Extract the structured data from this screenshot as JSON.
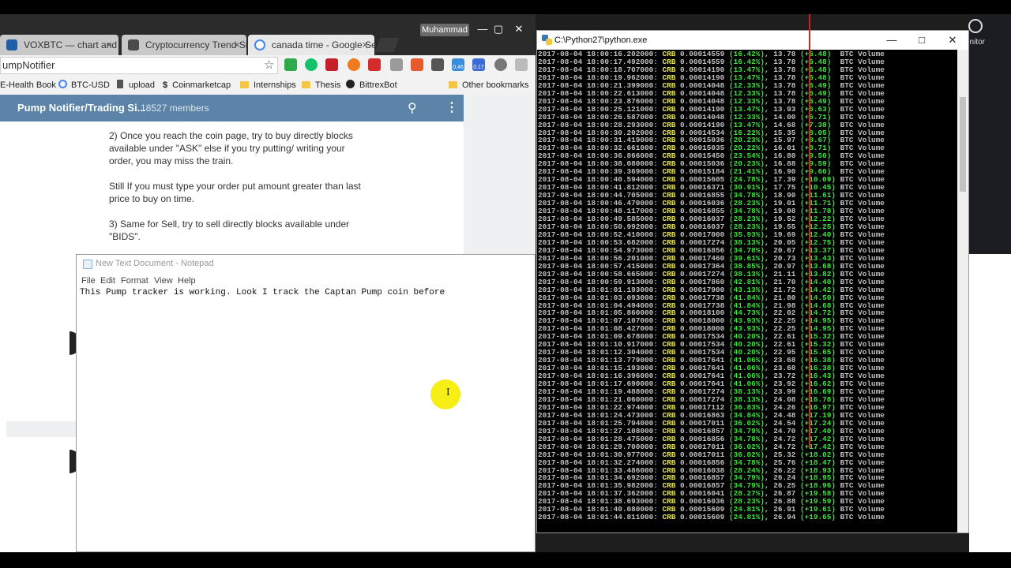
{
  "chrome": {
    "tabs": [
      {
        "label": "VOXBTC — chart and qu",
        "close": "×"
      },
      {
        "label": "Cryptocurrency Trend Si",
        "close": "×"
      },
      {
        "label": "canada time - Google Se",
        "close": "×"
      }
    ],
    "user": "Muhammad",
    "address": "umpNotifier",
    "ext_badges": {
      "a": "0.46",
      "b": "0.17"
    },
    "bookmarks": [
      "E-Health Book",
      "BTC-USD",
      "upload",
      "Coinmarketcap",
      "Internships",
      "Thesis",
      "BittrexBot",
      "Other bookmarks"
    ]
  },
  "telegram": {
    "title": "Pump Notifier/Trading Si...",
    "members": "18527 members",
    "paragraphs": [
      "2) Once you reach the coin page, try to buy directly blocks available under \"ASK\" else if you try putting/ writing your order, you may miss the train.",
      "Still If you must type your order put amount greater than last price to buy on time.",
      "3) Same for Sell, try to sell directly blocks available under \"BIDS\"."
    ]
  },
  "notepad": {
    "title": "New Text Document - Notepad",
    "menu": [
      "File",
      "Edit",
      "Format",
      "View",
      "Help"
    ],
    "content": "This Pump tracker is working. Look I track the Captan Pump coin before"
  },
  "console": {
    "title": "C:\\Python27\\python.exe",
    "lines": [
      [
        "2017-08-04 18:00:16.202000:",
        "CRB",
        "0.00014559",
        "(16.42%)",
        "13.78",
        "(+6.48)"
      ],
      [
        "2017-08-04 18:00:17.492000:",
        "CRB",
        "0.00014559",
        "(16.42%)",
        "13.78",
        "(+6.48)"
      ],
      [
        "2017-08-04 18:00:18.707000:",
        "CRB",
        "0.00014190",
        "(13.47%)",
        "13.78",
        "(+6.48)"
      ],
      [
        "2017-08-04 18:00:19.962000:",
        "CRB",
        "0.00014190",
        "(13.47%)",
        "13.78",
        "(+6.48)"
      ],
      [
        "2017-08-04 18:00:21.399000:",
        "CRB",
        "0.00014048",
        "(12.33%)",
        "13.78",
        "(+6.49)"
      ],
      [
        "2017-08-04 18:00:22.613000:",
        "CRB",
        "0.00014048",
        "(12.33%)",
        "13.78",
        "(+6.49)"
      ],
      [
        "2017-08-04 18:00:23.876000:",
        "CRB",
        "0.00014048",
        "(12.33%)",
        "13.78",
        "(+6.49)"
      ],
      [
        "2017-08-04 18:00:25.121000:",
        "CRB",
        "0.00014190",
        "(13.47%)",
        "13.93",
        "(+6.63)"
      ],
      [
        "2017-08-04 18:00:26.587000:",
        "CRB",
        "0.00014048",
        "(12.33%)",
        "14.00",
        "(+6.71)"
      ],
      [
        "2017-08-04 18:00:28.293000:",
        "CRB",
        "0.00014190",
        "(13.47%)",
        "14.68",
        "(+7.38)"
      ],
      [
        "2017-08-04 18:00:30.202000:",
        "CRB",
        "0.00014534",
        "(16.22%)",
        "15.35",
        "(+8.05)"
      ],
      [
        "2017-08-04 18:00:31.419000:",
        "CRB",
        "0.00015036",
        "(20.23%)",
        "15.97",
        "(+8.67)"
      ],
      [
        "2017-08-04 18:00:32.661000:",
        "CRB",
        "0.00015035",
        "(20.22%)",
        "16.01",
        "(+8.71)"
      ],
      [
        "2017-08-04 18:00:36.866000:",
        "CRB",
        "0.00015450",
        "(23.54%)",
        "16.80",
        "(+9.50)"
      ],
      [
        "2017-08-04 18:00:38.080000:",
        "CRB",
        "0.00015036",
        "(20.23%)",
        "16.88",
        "(+9.59)"
      ],
      [
        "2017-08-04 18:00:39.369000:",
        "CRB",
        "0.00015184",
        "(21.41%)",
        "16.90",
        "(+9.60)"
      ],
      [
        "2017-08-04 18:00:40.594000:",
        "CRB",
        "0.00015605",
        "(24.78%)",
        "17.39",
        "(+10.09)"
      ],
      [
        "2017-08-04 18:00:41.812000:",
        "CRB",
        "0.00016371",
        "(30.91%)",
        "17.75",
        "(+10.45)"
      ],
      [
        "2017-08-04 18:00:44.705000:",
        "CRB",
        "0.00016855",
        "(34.78%)",
        "18.90",
        "(+11.61)"
      ],
      [
        "2017-08-04 18:00:46.470000:",
        "CRB",
        "0.00016036",
        "(28.23%)",
        "19.01",
        "(+11.71)"
      ],
      [
        "2017-08-04 18:00:48.117000:",
        "CRB",
        "0.00016855",
        "(34.78%)",
        "19.08",
        "(+11.78)"
      ],
      [
        "2017-08-04 18:00:49.585000:",
        "CRB",
        "0.00016037",
        "(28.23%)",
        "19.52",
        "(+12.22)"
      ],
      [
        "2017-08-04 18:00:50.992000:",
        "CRB",
        "0.00016037",
        "(28.23%)",
        "19.55",
        "(+12.25)"
      ],
      [
        "2017-08-04 18:00:52.410000:",
        "CRB",
        "0.00017000",
        "(35.93%)",
        "19.69",
        "(+12.40)"
      ],
      [
        "2017-08-04 18:00:53.682000:",
        "CRB",
        "0.00017274",
        "(38.13%)",
        "20.05",
        "(+12.75)"
      ],
      [
        "2017-08-04 18:00:54.973000:",
        "CRB",
        "0.00016856",
        "(34.78%)",
        "20.67",
        "(+13.37)"
      ],
      [
        "2017-08-04 18:00:56.201000:",
        "CRB",
        "0.00017460",
        "(39.61%)",
        "20.73",
        "(+13.43)"
      ],
      [
        "2017-08-04 18:00:57.415000:",
        "CRB",
        "0.00017364",
        "(38.85%)",
        "20.97",
        "(+13.68)"
      ],
      [
        "2017-08-04 18:00:58.665000:",
        "CRB",
        "0.00017274",
        "(38.13%)",
        "21.11",
        "(+13.82)"
      ],
      [
        "2017-08-04 18:00:59.913000:",
        "CRB",
        "0.00017860",
        "(42.81%)",
        "21.70",
        "(+14.40)"
      ],
      [
        "2017-08-04 18:01:01.193000:",
        "CRB",
        "0.00017900",
        "(43.13%)",
        "21.72",
        "(+14.42)"
      ],
      [
        "2017-08-04 18:01:03.093000:",
        "CRB",
        "0.00017738",
        "(41.84%)",
        "21.80",
        "(+14.50)"
      ],
      [
        "2017-08-04 18:01:04.494000:",
        "CRB",
        "0.00017738",
        "(41.84%)",
        "21.98",
        "(+14.68)"
      ],
      [
        "2017-08-04 18:01:05.860000:",
        "CRB",
        "0.00018100",
        "(44.73%)",
        "22.02",
        "(+14.72)"
      ],
      [
        "2017-08-04 18:01:07.107000:",
        "CRB",
        "0.00018000",
        "(43.93%)",
        "22.25",
        "(+14.95)"
      ],
      [
        "2017-08-04 18:01:08.427000:",
        "CRB",
        "0.00018000",
        "(43.93%)",
        "22.25",
        "(+14.95)"
      ],
      [
        "2017-08-04 18:01:09.678000:",
        "CRB",
        "0.00017534",
        "(40.20%)",
        "22.61",
        "(+15.32)"
      ],
      [
        "2017-08-04 18:01:10.917000:",
        "CRB",
        "0.00017534",
        "(40.20%)",
        "22.61",
        "(+15.32)"
      ],
      [
        "2017-08-04 18:01:12.304000:",
        "CRB",
        "0.00017534",
        "(40.20%)",
        "22.95",
        "(+15.65)"
      ],
      [
        "2017-08-04 18:01:13.779000:",
        "CRB",
        "0.00017641",
        "(41.06%)",
        "23.68",
        "(+16.38)"
      ],
      [
        "2017-08-04 18:01:15.193000:",
        "CRB",
        "0.00017641",
        "(41.06%)",
        "23.68",
        "(+16.38)"
      ],
      [
        "2017-08-04 18:01:16.396000:",
        "CRB",
        "0.00017641",
        "(41.06%)",
        "23.72",
        "(+16.43)"
      ],
      [
        "2017-08-04 18:01:17.690000:",
        "CRB",
        "0.00017641",
        "(41.06%)",
        "23.92",
        "(+16.62)"
      ],
      [
        "2017-08-04 18:01:19.488000:",
        "CRB",
        "0.00017274",
        "(38.13%)",
        "23.99",
        "(+16.69)"
      ],
      [
        "2017-08-04 18:01:21.060000:",
        "CRB",
        "0.00017274",
        "(38.13%)",
        "24.08",
        "(+16.78)"
      ],
      [
        "2017-08-04 18:01:22.974000:",
        "CRB",
        "0.00017112",
        "(36.83%)",
        "24.26",
        "(+16.97)"
      ],
      [
        "2017-08-04 18:01:24.473000:",
        "CRB",
        "0.00016863",
        "(34.84%)",
        "24.48",
        "(+17.19)"
      ],
      [
        "2017-08-04 18:01:25.794000:",
        "CRB",
        "0.00017011",
        "(36.02%)",
        "24.54",
        "(+17.24)"
      ],
      [
        "2017-08-04 18:01:27.108000:",
        "CRB",
        "0.00016857",
        "(34.79%)",
        "24.70",
        "(+17.40)"
      ],
      [
        "2017-08-04 18:01:28.475000:",
        "CRB",
        "0.00016856",
        "(34.78%)",
        "24.72",
        "(+17.42)"
      ],
      [
        "2017-08-04 18:01:29.700000:",
        "CRB",
        "0.00017011",
        "(36.02%)",
        "24.72",
        "(+17.42)"
      ],
      [
        "2017-08-04 18:01:30.977000:",
        "CRB",
        "0.00017011",
        "(36.02%)",
        "25.32",
        "(+18.02)"
      ],
      [
        "2017-08-04 18:01:32.274000:",
        "CRB",
        "0.00016856",
        "(34.78%)",
        "25.76",
        "(+18.47)"
      ],
      [
        "2017-08-04 18:01:33.486000:",
        "CRB",
        "0.00016038",
        "(28.24%)",
        "26.22",
        "(+18.93)"
      ],
      [
        "2017-08-04 18:01:34.692000:",
        "CRB",
        "0.00016857",
        "(34.79%)",
        "26.24",
        "(+18.95)"
      ],
      [
        "2017-08-04 18:01:35.982000:",
        "CRB",
        "0.00016857",
        "(34.79%)",
        "26.25",
        "(+18.96)"
      ],
      [
        "2017-08-04 18:01:37.362000:",
        "CRB",
        "0.00016041",
        "(28.27%)",
        "26.87",
        "(+19.58)"
      ],
      [
        "2017-08-04 18:01:38.693000:",
        "CRB",
        "0.00016036",
        "(28.23%)",
        "26.88",
        "(+19.59)"
      ],
      [
        "2017-08-04 18:01:40.080000:",
        "CRB",
        "0.00015609",
        "(24.81%)",
        "26.91",
        "(+19.61)"
      ],
      [
        "2017-08-04 18:01:44.811000:",
        "CRB",
        "0.00015609",
        "(24.81%)",
        "26.94",
        "(+19.65)"
      ]
    ],
    "suffix": "BTC Volume"
  },
  "desktop": {
    "monitor_label": "onitor"
  }
}
